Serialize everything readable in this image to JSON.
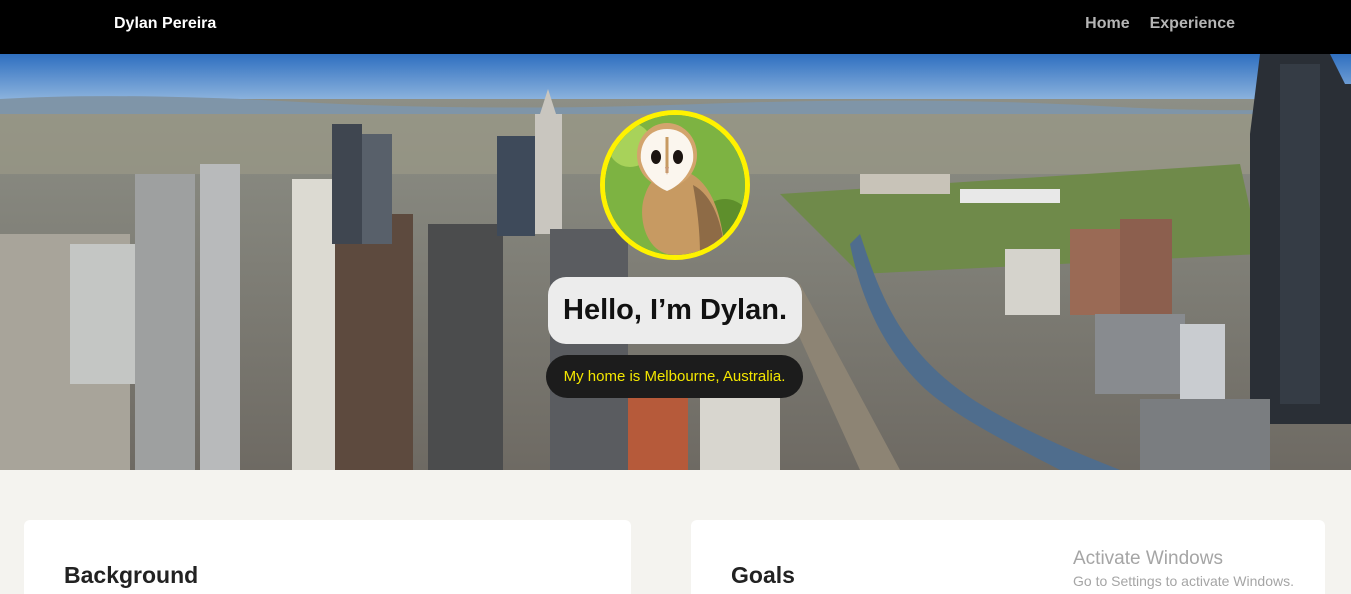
{
  "nav": {
    "brand": "Dylan Pereira",
    "links": [
      "Home",
      "Experience"
    ]
  },
  "hero": {
    "background": "melbourne-aerial-cityscape",
    "avatar": "barn-owl-photo",
    "greeting": "Hello, I’m Dylan.",
    "tagline": "My home is Melbourne, Australia."
  },
  "sections": {
    "background_title": "Background",
    "goals_title": "Goals"
  },
  "watermark": {
    "line1": "Activate Windows",
    "line2": "Go to Settings to activate Windows."
  },
  "colors": {
    "nav_bg": "#000000",
    "accent_yellow": "#fff200",
    "tagline_text": "#f4e700",
    "page_bg": "#f4f3ef"
  }
}
